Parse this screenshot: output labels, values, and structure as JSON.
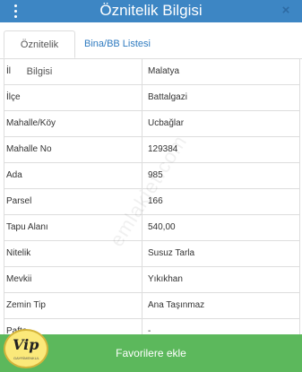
{
  "header": {
    "title": "Öznitelik Bilgisi",
    "close_icon": "×",
    "menu_icon": "vertical-ellipsis"
  },
  "tabs": [
    {
      "label": "Öznitelik Bilgisi",
      "active": true
    },
    {
      "label": "Bina/BB Listesi",
      "active": false
    }
  ],
  "rows": [
    {
      "key": "İl",
      "value": "Malatya"
    },
    {
      "key": "İlçe",
      "value": "Battalgazi"
    },
    {
      "key": "Mahalle/Köy",
      "value": "Ucbağlar"
    },
    {
      "key": "Mahalle No",
      "value": "129384"
    },
    {
      "key": "Ada",
      "value": "985"
    },
    {
      "key": "Parsel",
      "value": "166"
    },
    {
      "key": "Tapu Alanı",
      "value": "540,00"
    },
    {
      "key": "Nitelik",
      "value": "Susuz Tarla"
    },
    {
      "key": "Mevkii",
      "value": "Yıkıkhan"
    },
    {
      "key": "Zemin Tip",
      "value": "Ana Taşınmaz"
    },
    {
      "key": "Pafta",
      "value": "-"
    }
  ],
  "watermark": "emlakjet.com",
  "footer": {
    "button_label": "Favorilere ekle"
  },
  "logo": {
    "text": "Vip",
    "subtext": "GAYRİMENKUL"
  },
  "colors": {
    "header": "#3d86c4",
    "footer_button": "#5cb85c",
    "tab_link": "#2f7bc0"
  }
}
